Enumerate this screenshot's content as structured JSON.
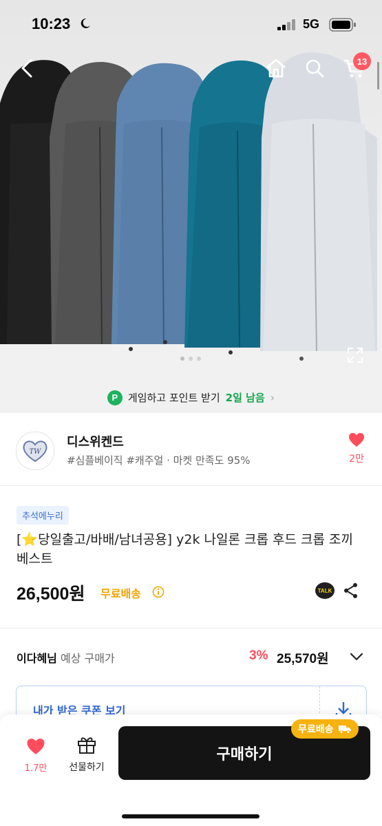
{
  "status_bar": {
    "time": "10:23",
    "network": "5G"
  },
  "cart": {
    "count": "13"
  },
  "game_banner": {
    "text": "게임하고 포인트 받기",
    "highlight": "2일 남음",
    "icon_letter": "P"
  },
  "store": {
    "name": "디스위켄드",
    "tags": "#심플베이직 #캐주얼 · 마켓 만족도 95%",
    "like_count": "2만"
  },
  "product": {
    "chip": "추석에누리",
    "title": "[⭐당일출고/바배/남녀공용] y2k 나일론 크롭 후드 크롭 조끼 베스트",
    "price": "26,500원",
    "shipping": "무료배송",
    "talk_label": "TALK"
  },
  "member_price": {
    "name": "이다혜님",
    "label": "예상 구매가",
    "discount": "3%",
    "final_price": "25,570원"
  },
  "coupon": {
    "label": "내가 받은 쿠폰 보기"
  },
  "bottom_bar": {
    "like_count": "1.7만",
    "gift_label": "선물하기",
    "buy_label": "구매하기",
    "ship_badge": "무료배송"
  },
  "colors": {
    "accent_red": "#ff4d5d",
    "brand_green": "#14a54f",
    "ship_yellow": "#f6b20f",
    "coupon_blue": "#2f67d3",
    "vest_colors": [
      "#1a1a1a",
      "#545454",
      "#5b83ad",
      "#136f88",
      "#d8dde4"
    ]
  },
  "icons": [
    "back-icon",
    "home-icon",
    "search-icon",
    "cart-icon",
    "heart-icon",
    "info-icon",
    "share-icon",
    "chevron-down-icon",
    "download-icon",
    "gift-icon",
    "truck-icon",
    "expand-icon"
  ]
}
